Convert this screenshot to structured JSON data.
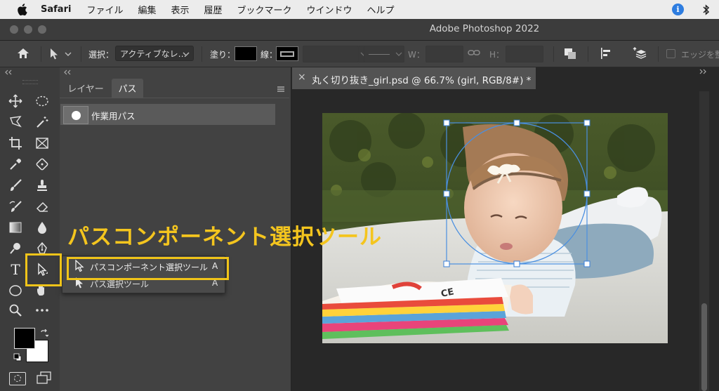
{
  "menubar": {
    "app": "Safari",
    "items": [
      "ファイル",
      "編集",
      "表示",
      "履歴",
      "ブックマーク",
      "ウインドウ",
      "ヘルプ"
    ],
    "info_icon_glyph": "i"
  },
  "window": {
    "title": "Adobe Photoshop 2022"
  },
  "options_bar": {
    "select_label": "選択：",
    "select_value": "アクティブなレ…",
    "fill_label": "塗り：",
    "stroke_label": "線：",
    "w_label": "W：",
    "h_label": "H：",
    "edge_label": "エッジを整"
  },
  "panel": {
    "tabs": [
      "レイヤー",
      "パス"
    ],
    "active_tab": "パス",
    "path_name": "作業用パス"
  },
  "document": {
    "tab_title": "丸く切り抜き_girl.psd @ 66.7% (girl, RGB/8#) *",
    "close_glyph": "×"
  },
  "flyout": {
    "items": [
      {
        "label": "パスコンポーネント選択ツール",
        "shortcut": "A"
      },
      {
        "label": "パス選択ツール",
        "shortcut": "A"
      }
    ]
  },
  "annotation": {
    "callout": "パスコンポーネント選択ツール"
  },
  "colors": {
    "highlight": "#f0c419",
    "callout": "#f4c51e",
    "bezier": "#4a8fe0",
    "accent_info": "#2e7de0"
  }
}
